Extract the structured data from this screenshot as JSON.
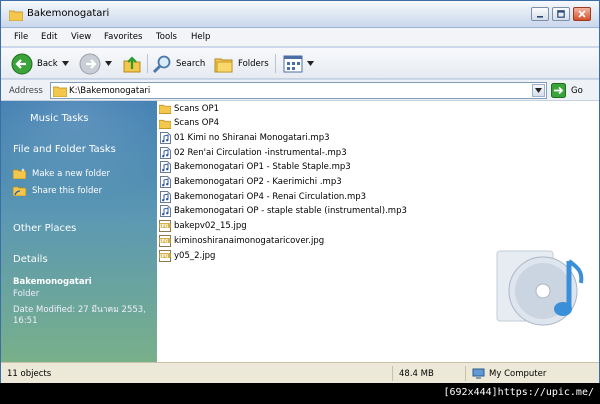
{
  "window": {
    "title": "Bakemonogatari"
  },
  "menu": [
    {
      "key": "F",
      "rest": "ile"
    },
    {
      "key": "E",
      "rest": "dit"
    },
    {
      "key": "V",
      "rest": "iew"
    },
    {
      "key": "F",
      "rest": "avorites",
      "pre": "F",
      "label_full": "Favorites"
    },
    {
      "key": "T",
      "rest": "ools"
    },
    {
      "key": "H",
      "rest": "elp"
    }
  ],
  "menu_labels": {
    "file": "File",
    "edit": "Edit",
    "view": "View",
    "favorites": "Favorites",
    "tools": "Tools",
    "help": "Help"
  },
  "toolbar": {
    "back_label": "Back",
    "search_label": "Search",
    "folders_label": "Folders"
  },
  "address": {
    "label": "Address",
    "value": "K:\\Bakemonogatari",
    "go_label": "Go"
  },
  "sidebar": {
    "music_tasks": "Music Tasks",
    "file_folder_tasks": "File and Folder Tasks",
    "make_new_folder": "Make a new folder",
    "share_folder": "Share this folder",
    "other_places": "Other Places",
    "details": "Details",
    "detail_name": "Bakemonogatari",
    "detail_type": "Folder",
    "detail_modified": "Date Modified: 27 มีนาคม 2553, 16:51"
  },
  "files": [
    {
      "name": "Scans OP1",
      "icon": "folder-icon"
    },
    {
      "name": "Scans OP4",
      "icon": "folder-icon"
    },
    {
      "name": "01 Kimi no Shiranai Monogatari.mp3",
      "icon": "music-file-icon"
    },
    {
      "name": "02 Ren'ai Circulation -instrumental-.mp3",
      "icon": "music-file-icon"
    },
    {
      "name": "Bakemonogatari OP1 - Stable Staple.mp3",
      "icon": "music-file-icon"
    },
    {
      "name": "Bakemonogatari OP2 - Kaerimichi .mp3",
      "icon": "music-file-icon"
    },
    {
      "name": "Bakemonogatari OP4 - Renai Circulation.mp3",
      "icon": "music-file-icon"
    },
    {
      "name": "Bakemonogatari OP - staple stable (instrumental).mp3",
      "icon": "music-file-icon"
    },
    {
      "name": "bakepv02_15.jpg",
      "icon": "jpg-file-icon"
    },
    {
      "name": "kiminoshiranaimonogataricover.jpg",
      "icon": "jpg-file-icon"
    },
    {
      "name": "y05_2.jpg",
      "icon": "jpg-file-icon"
    }
  ],
  "status": {
    "objects": "11 objects",
    "size": "48.4 MB",
    "location": "My Computer"
  },
  "footer": {
    "text": "[692x444]https://upic.me/"
  }
}
